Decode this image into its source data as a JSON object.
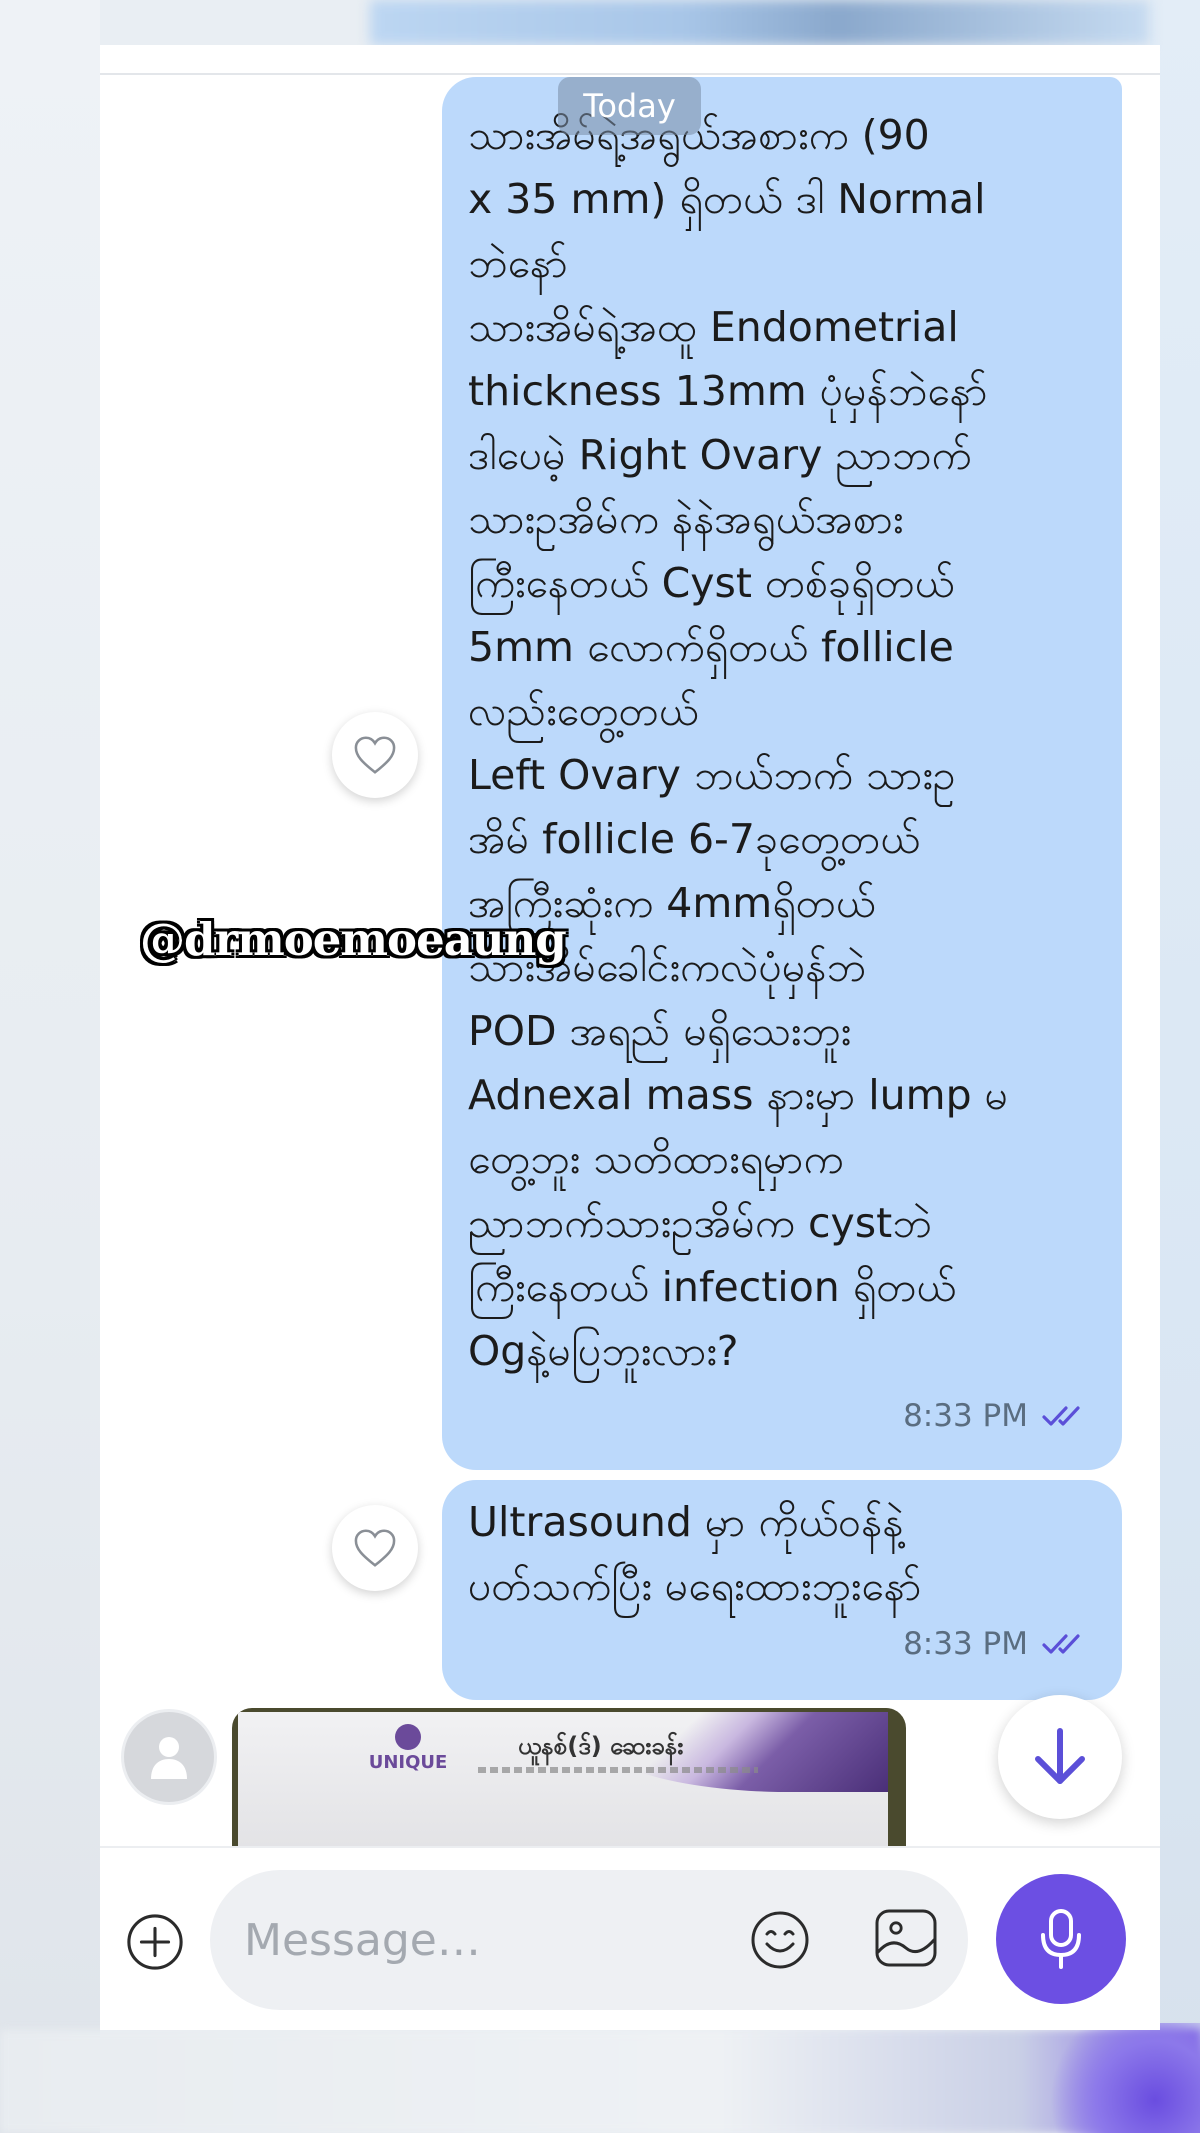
{
  "header": {
    "date_label": "Today"
  },
  "watermark": "@drmoemoeaung",
  "messages": [
    {
      "lines": [
        "သားအိမ်ရဲ့အရွယ်အစားက (90",
        "x 35 mm)  ရှိတယ် ဒါ Normal",
        "ဘဲနော်",
        "သားအိမ်ရဲ့အထူ Endometrial",
        "thickness 13mm ပုံမှန်ဘဲနော်",
        "ဒါပေမဲ့ Right Ovary ညာဘက်",
        "သားဥအိမ်က နဲနဲအရွယ်အစား",
        "ကြီးနေတယ် Cyst တစ်ခုရှိတယ်",
        "5mm လောက်ရှိတယ် follicle",
        "လည်းတွေ့တယ်",
        "Left Ovary ဘယ်ဘက် သားဥ",
        "အိမ် follicle 6-7ခုတွေ့တယ်",
        "အကြီးဆုံးက 4mmရှိတယ်",
        "သားအိမ်ခေါင်းကလဲပုံမှန်ဘဲ",
        "POD အရည် မရှိသေးဘူး",
        "Adnexal mass နားမှာ lump မ",
        "တွေ့ဘူး သတိထားရမှာက",
        "ညာဘက်သားဥအိမ်က cystဘဲ",
        "ကြီးနေတယ် infection ရှိတယ်",
        "Ogနဲ့မပြဘူးလား?"
      ],
      "time": "8:33 PM"
    },
    {
      "lines": [
        "Ultrasound မှာ ကိုယ်ဝန်နဲ့",
        "ပတ်သက်ပြီး မရေးထားဘူးနော်"
      ],
      "time": "8:33 PM"
    }
  ],
  "photo_message": {
    "brand": "UNIQUE",
    "title": "ယူနစ်(ဒ်) ဆေးခန်း"
  },
  "composer": {
    "placeholder": "Message…"
  },
  "icons": {
    "heart": "heart-icon",
    "read_ticks": "double-check-icon",
    "plus": "plus-circle-icon",
    "emoji": "smiley-icon",
    "gallery": "image-icon",
    "mic": "microphone-icon",
    "scroll_down": "arrow-down-icon",
    "avatar": "user-icon"
  },
  "colors": {
    "bubble": "#bcd9fb",
    "accent": "#6c4fe3",
    "ticks": "#5b4fd8"
  }
}
